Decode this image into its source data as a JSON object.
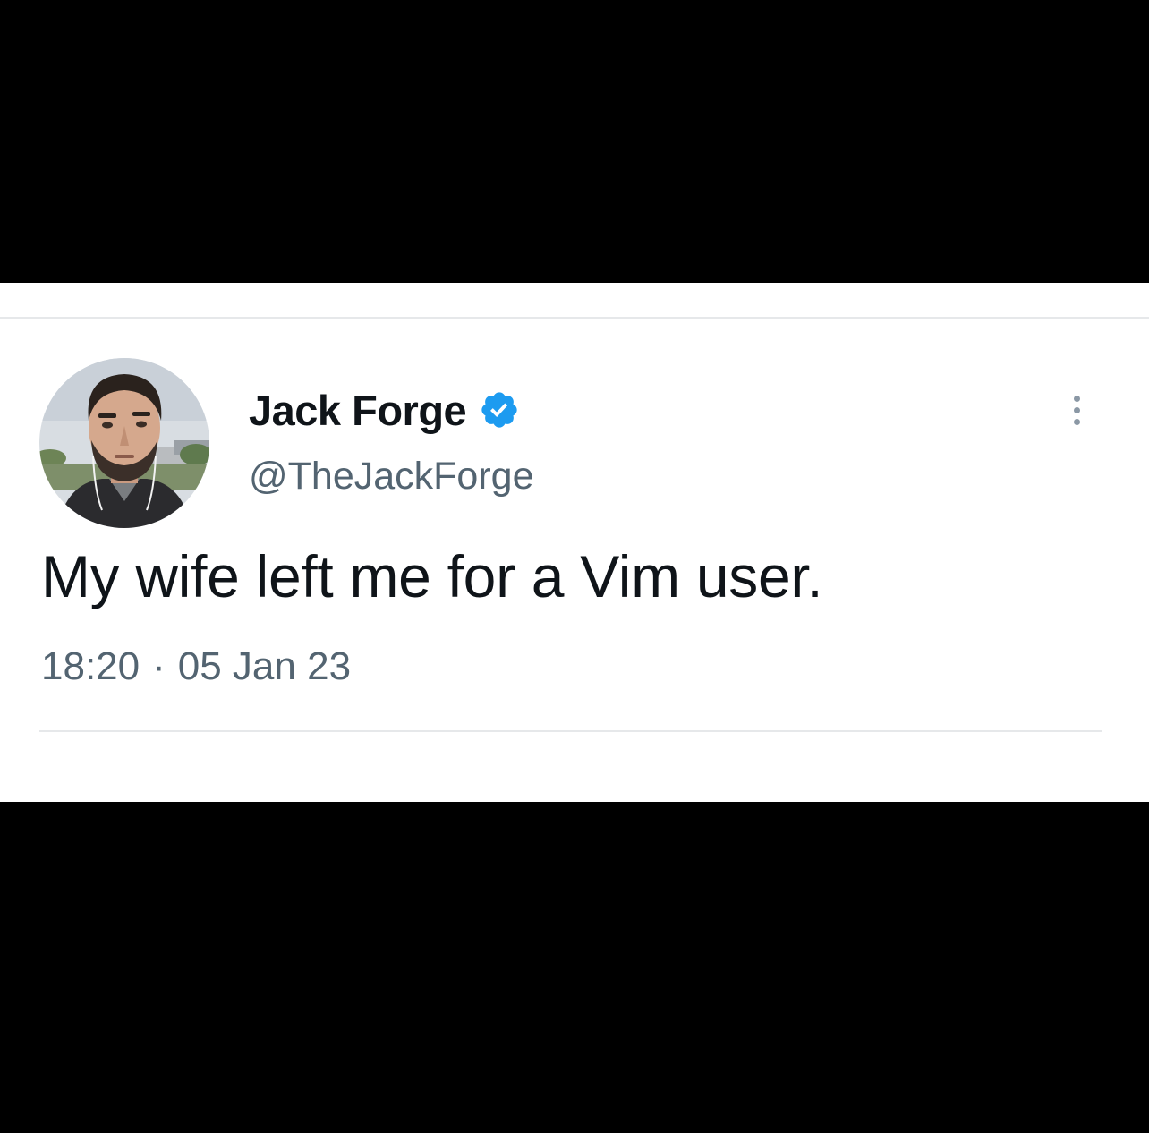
{
  "tweet": {
    "display_name": "Jack Forge",
    "handle": "@TheJackForge",
    "text": "My wife left me for a Vim user.",
    "time": "18:20",
    "separator": "·",
    "date": "05 Jan 23",
    "verified": true
  },
  "icons": {
    "verified": "verified-badge-icon",
    "more": "more-options-icon"
  },
  "colors": {
    "background_band": "#000000",
    "card": "#ffffff",
    "primary_text": "#0f1419",
    "secondary_text": "#536471",
    "verified_blue": "#1d9bf0",
    "divider": "#e6e8ea"
  }
}
